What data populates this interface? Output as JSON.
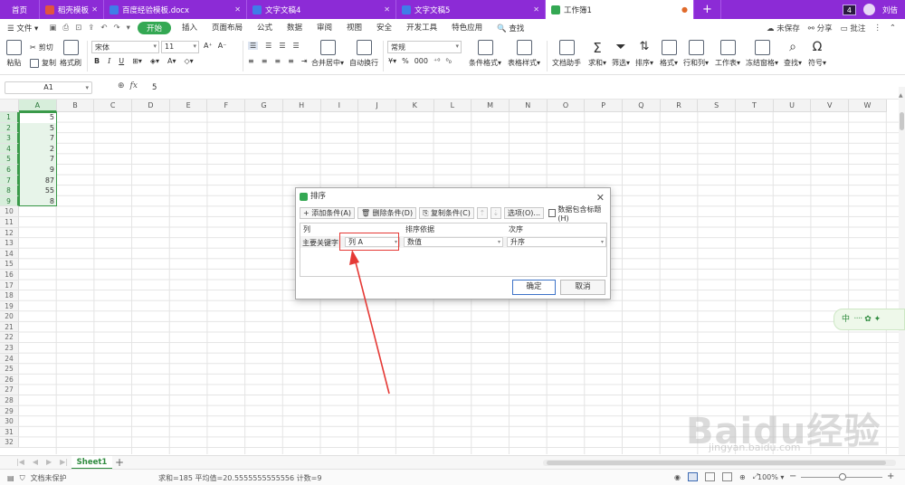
{
  "tabs": [
    {
      "label": "首页",
      "icon": ""
    },
    {
      "label": "稻壳模板",
      "icon": "daoke-icon",
      "color": "#e2543f"
    },
    {
      "label": "百度经验模板.docx",
      "icon": "writer-icon",
      "color": "#3f7de8"
    },
    {
      "label": "文字文稿4",
      "icon": "writer-icon",
      "color": "#3f7de8"
    },
    {
      "label": "文字文稿5",
      "icon": "writer-icon",
      "color": "#3f7de8"
    },
    {
      "label": "工作簿1",
      "icon": "sheet-icon",
      "color": "#34a853",
      "active": true
    }
  ],
  "tabbar_right": {
    "count": "4",
    "user": "刘佶"
  },
  "menu": {
    "file": "文件",
    "items": [
      "开始",
      "插入",
      "页面布局",
      "公式",
      "数据",
      "审阅",
      "视图",
      "安全",
      "开发工具",
      "特色应用"
    ],
    "search": "查找",
    "right": {
      "unsaved": "未保存",
      "share": "分享",
      "comment": "批注"
    }
  },
  "ribbon": {
    "paste": "粘贴",
    "cut": "剪切",
    "copy": "复制",
    "format_painter": "格式刷",
    "font": "宋体",
    "size": "11",
    "number_format": "常规",
    "merge": "合并居中",
    "wrap": "自动换行",
    "cond_format": "条件格式",
    "table_style": "表格样式",
    "doc_helper": "文档助手",
    "sum": "求和",
    "filter": "筛选",
    "sort": "排序",
    "format": "格式",
    "rowcol": "行和列",
    "worksheet": "工作表",
    "freeze": "冻结窗格",
    "find": "查找",
    "symbol": "符号"
  },
  "formula_bar": {
    "name_box": "A1",
    "fx": "fx",
    "value": "5"
  },
  "columns": [
    "A",
    "B",
    "C",
    "D",
    "E",
    "F",
    "G",
    "H",
    "I",
    "J",
    "K",
    "L",
    "M",
    "N",
    "O",
    "P",
    "Q",
    "R",
    "S",
    "T",
    "U",
    "V",
    "W"
  ],
  "rows": [
    "1",
    "2",
    "3",
    "4",
    "5",
    "6",
    "7",
    "8",
    "9",
    "10",
    "11",
    "12",
    "13",
    "14",
    "15",
    "16",
    "17",
    "18",
    "19",
    "20",
    "21",
    "22",
    "23",
    "24",
    "25",
    "26",
    "27",
    "28",
    "29",
    "30",
    "31",
    "32"
  ],
  "column_a_values": [
    "5",
    "5",
    "7",
    "2",
    "7",
    "9",
    "87",
    "55",
    "8"
  ],
  "dialog": {
    "title": "排序",
    "add": "添加条件(A)",
    "delete": "删除条件(D)",
    "copy": "复制条件(C)",
    "options": "选项(O)...",
    "has_header": "数据包含标题(H)",
    "col_header": "列",
    "basis_header": "排序依据",
    "order_header": "次序",
    "row_label": "主要关键字",
    "column_value": "列 A",
    "basis_value": "数值",
    "order_value": "升序",
    "ok": "确定",
    "cancel": "取消"
  },
  "sheet_tab": "Sheet1",
  "status": {
    "protect": "文档未保护",
    "stats": "求和=185  平均值=20.5555555555556  计数=9",
    "zoom": "100%"
  },
  "ime": "中",
  "watermark": {
    "main": "Baidu经验",
    "sub": "jingyan.baidu.com"
  },
  "colors": {
    "accent": "#8c2bd6",
    "green": "#34a853",
    "highlight": "#e53935"
  }
}
